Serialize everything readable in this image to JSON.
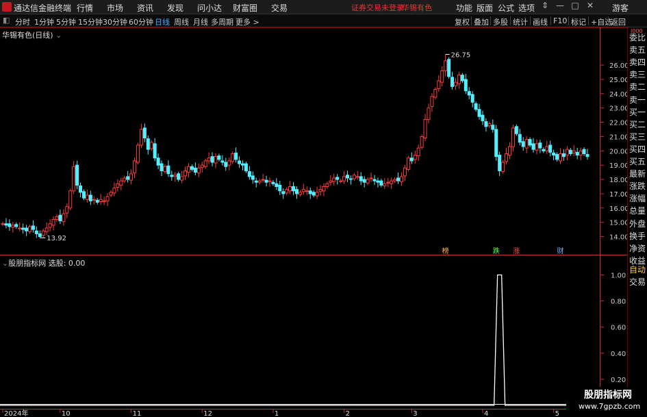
{
  "app": {
    "title": "通达信金融终端"
  },
  "menu": [
    "行情",
    "市场",
    "资讯",
    "发现",
    "问小达",
    "财富圈",
    "交易"
  ],
  "notice": {
    "trade": "证券交易未登录",
    "stock": "华锡有色"
  },
  "right_menu": [
    "功能",
    "版面",
    "公式",
    "选项"
  ],
  "window_controls": {
    "collapse": "⇕",
    "min": "—",
    "max": "□",
    "close": "✕"
  },
  "guest": "游客",
  "periods": [
    "分时",
    "1分钟",
    "5分钟",
    "15分钟",
    "30分钟",
    "60分钟",
    "日线",
    "周线",
    "月线",
    "多周期",
    "更多 >"
  ],
  "active_period": "日线",
  "toolbar": [
    "复权",
    "叠加",
    "多股",
    "统计",
    "画线",
    "F10",
    "标记",
    "+自选",
    "返回"
  ],
  "stock_title": "华锡有色(日线)",
  "indicator": {
    "name": "股朋指标网",
    "value": "选股: 0.00"
  },
  "quote_panel": {
    "top": "I000",
    "items": [
      "委比",
      "卖五",
      "卖四",
      "卖三",
      "卖二",
      "卖一",
      "买一",
      "买二",
      "买三",
      "买四",
      "买五",
      "最新",
      "涨跌",
      "涨幅",
      "总量",
      "外盘",
      "换手",
      "净资",
      "收益"
    ],
    "bottom": [
      "自动",
      "交易"
    ]
  },
  "colors": {
    "up": "#ff3c3c",
    "down": "#52f0ff",
    "axis": "#c83232",
    "ma": "#ffffff",
    "signal": "#ffffff",
    "tag_buy": "#ffb24c",
    "tag_fall": "#4cff4c",
    "tag_rise": "#ff4c4c",
    "tag_fin": "#6ab4ff"
  },
  "chart_data": [
    {
      "type": "candlestick",
      "title": "华锡有色(日线)",
      "ylim": [
        13.5,
        27.2
      ],
      "yticks": [
        14,
        15,
        16,
        17,
        18,
        19,
        20,
        21,
        22,
        23,
        24,
        25,
        26
      ],
      "xlabels": [
        "2024年",
        "10",
        "11",
        "12",
        "1",
        "2",
        "3",
        "4",
        "5"
      ],
      "annotations": [
        {
          "text": "26.75",
          "type": "high"
        },
        {
          "text": "13.92",
          "type": "low"
        }
      ],
      "event_tags": [
        "榜",
        "跌",
        "涨",
        "财"
      ],
      "closes": [
        14.9,
        14.8,
        14.7,
        14.8,
        14.7,
        14.6,
        14.5,
        14.4,
        14.7,
        14.5,
        14.2,
        14.0,
        14.4,
        14.6,
        14.9,
        15.2,
        15.4,
        15.1,
        15.6,
        16.1,
        17.2,
        18.9,
        17.6,
        17.1,
        16.7,
        16.9,
        16.5,
        16.6,
        16.4,
        16.6,
        16.5,
        16.8,
        17.1,
        17.4,
        17.7,
        17.9,
        18.1,
        18.0,
        18.4,
        19.3,
        20.4,
        21.5,
        20.9,
        20.1,
        20.6,
        19.5,
        19.0,
        18.6,
        18.9,
        18.4,
        18.2,
        18.3,
        18.0,
        18.2,
        18.6,
        18.9,
        18.7,
        18.5,
        18.8,
        19.0,
        19.3,
        19.5,
        19.2,
        19.6,
        19.4,
        19.2,
        18.9,
        19.3,
        19.8,
        19.4,
        19.1,
        19.0,
        18.6,
        18.2,
        18.0,
        17.8,
        17.9,
        18.0,
        17.8,
        17.9,
        17.7,
        17.5,
        17.2,
        17.0,
        17.3,
        17.5,
        17.2,
        17.0,
        17.1,
        17.3,
        17.2,
        17.0,
        16.9,
        17.1,
        17.3,
        17.5,
        17.7,
        17.9,
        18.1,
        18.0,
        17.9,
        18.2,
        18.1,
        18.0,
        18.3,
        18.2,
        17.9,
        17.8,
        18.0,
        18.1,
        17.9,
        17.8,
        17.6,
        17.7,
        17.8,
        17.9,
        18.0,
        17.9,
        18.2,
        18.8,
        19.5,
        19.3,
        19.7,
        20.2,
        21.0,
        22.2,
        23.0,
        23.8,
        24.3,
        24.9,
        25.6,
        26.3,
        25.2,
        24.5,
        24.8,
        25.3,
        24.9,
        24.2,
        23.9,
        23.4,
        22.9,
        22.4,
        22.1,
        21.7,
        21.9,
        21.5,
        19.6,
        18.6,
        19.2,
        19.8,
        20.3,
        21.6,
        21.2,
        20.6,
        20.3,
        20.8,
        20.4,
        20.1,
        20.5,
        20.2,
        20.0,
        20.3,
        19.9,
        19.7,
        19.4,
        19.8,
        19.6,
        20.1,
        19.8,
        20.0,
        19.7,
        20.0,
        19.8,
        19.6
      ]
    },
    {
      "type": "line",
      "name": "股朋指标网",
      "series": [
        {
          "name": "选股",
          "values": [
            0
          ]
        }
      ],
      "ylim": [
        0,
        1.05
      ],
      "yticks": [
        0.2,
        0.4,
        0.6,
        0.8,
        1.0
      ],
      "spike": {
        "value": 1.0,
        "at_candle": 147
      }
    }
  ],
  "watermark": {
    "line1": "股朋指标网",
    "line2": "www.7gpzb.com"
  }
}
